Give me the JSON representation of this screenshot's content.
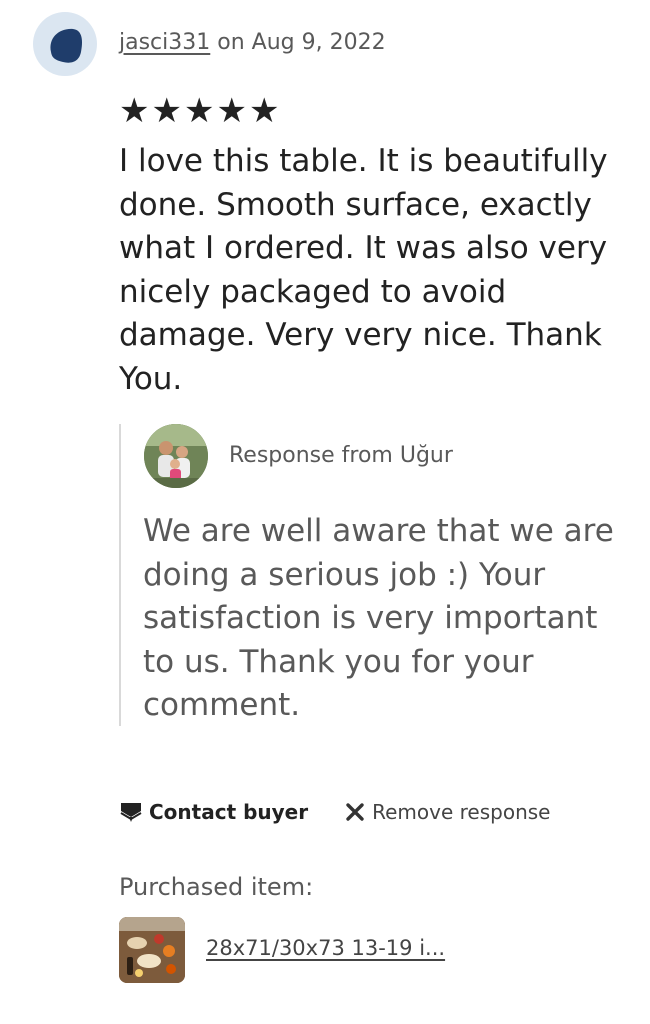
{
  "review": {
    "username": "jasci331",
    "date_text": " on Aug 9, 2022",
    "stars": [
      "★",
      "★",
      "★",
      "★",
      "★"
    ],
    "rating": 5,
    "text": "I love this table. It is beautifully done. Smooth surface, exactly what I ordered. It was also very nicely packaged to avoid damage. Very very nice. Thank You."
  },
  "response": {
    "from_label": "Response from Uğur",
    "text": "We are well aware that we are doing a serious job :) Your satisfaction is very important to us. Thank you for your comment."
  },
  "actions": {
    "contact_label": "Contact buyer",
    "remove_label": "Remove response",
    "contact_icon": "envelope-icon",
    "remove_icon": "close-icon"
  },
  "purchased": {
    "label": "Purchased item:",
    "item_title": "28x71/30x73 13-19 i..."
  },
  "colors": {
    "avatar_bg": "#dbe6f1",
    "avatar_shape": "#1f3d6b",
    "muted_text": "#595959",
    "primary_text": "#222222",
    "divider": "#d9d9d9"
  }
}
